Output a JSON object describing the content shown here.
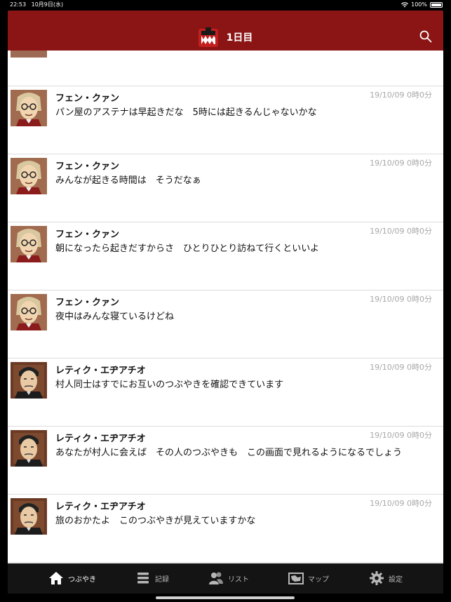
{
  "status": {
    "time": "22:53",
    "date": "10月9日(水)",
    "battery": "100%"
  },
  "header": {
    "title": "1日目"
  },
  "posts": [
    {
      "name": "フェン・クァン",
      "time": "19/10/09 0時0分",
      "message": "パン屋のアステナは早起きだな　5時には起きるんじゃないかな",
      "avatar": "fen-avatar"
    },
    {
      "name": "フェン・クァン",
      "time": "19/10/09 0時0分",
      "message": "みんなが起きる時間は　そうだなぁ",
      "avatar": "fen-avatar"
    },
    {
      "name": "フェン・クァン",
      "time": "19/10/09 0時0分",
      "message": "朝になったら起きだすからさ　ひとりひとり訪ねて行くといいよ",
      "avatar": "fen-avatar"
    },
    {
      "name": "フェン・クァン",
      "time": "19/10/09 0時0分",
      "message": "夜中はみんな寝ているけどね",
      "avatar": "fen-avatar"
    },
    {
      "name": "レティク・エヂアチオ",
      "time": "19/10/09 0時0分",
      "message": "村人同士はすでにお互いのつぶやきを確認できています",
      "avatar": "retik-avatar"
    },
    {
      "name": "レティク・エヂアチオ",
      "time": "19/10/09 0時0分",
      "message": "あなたが村人に会えば　その人のつぶやきも　この画面で見れるようになるでしょう",
      "avatar": "retik-avatar"
    },
    {
      "name": "レティク・エヂアチオ",
      "time": "19/10/09 0時0分",
      "message": "旅のおかたよ　このつぶやきが見えていますかな",
      "avatar": "retik-avatar"
    }
  ],
  "tabs": [
    {
      "label": "つぶやき",
      "icon": "home-icon",
      "active": true
    },
    {
      "label": "記録",
      "icon": "list-lines-icon",
      "active": false
    },
    {
      "label": "リスト",
      "icon": "people-icon",
      "active": false
    },
    {
      "label": "マップ",
      "icon": "map-icon",
      "active": false
    },
    {
      "label": "設定",
      "icon": "gear-icon",
      "active": false
    }
  ],
  "colors": {
    "header": "#8b1414",
    "tabbar": "#141414",
    "time": "#a8a8a8"
  }
}
